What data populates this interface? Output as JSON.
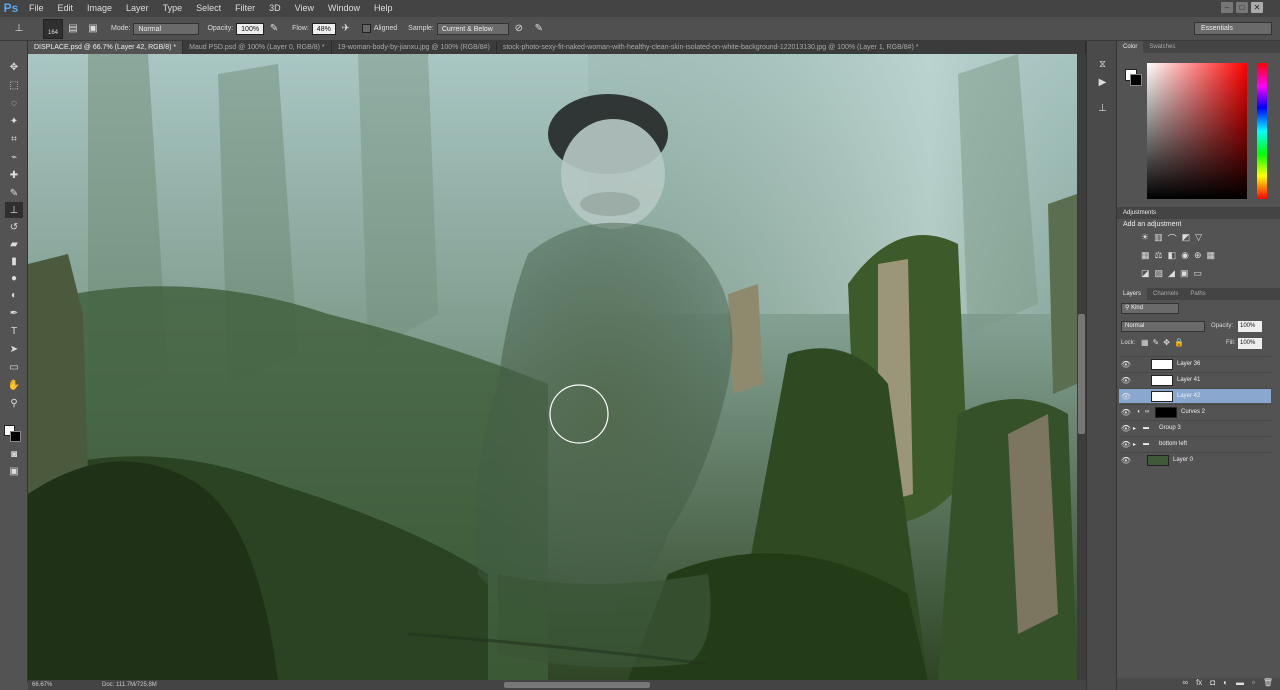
{
  "app": {
    "logo": "Ps"
  },
  "menu": [
    "File",
    "Edit",
    "Image",
    "Layer",
    "Type",
    "Select",
    "Filter",
    "3D",
    "View",
    "Window",
    "Help"
  ],
  "options": {
    "brush_size": "164",
    "mode_label": "Mode:",
    "mode_value": "Normal",
    "opacity_label": "Opacity:",
    "opacity_value": "100%",
    "flow_label": "Flow:",
    "flow_value": "48%",
    "aligned_label": "Aligned",
    "sample_label": "Sample:",
    "sample_value": "Current & Below",
    "workspace": "Essentials"
  },
  "tabs": [
    "DISPLACE.psd @ 66.7% (Layer 42, RGB/8) *",
    "Maud PSD.psd @ 100% (Layer 0, RGB/8) *",
    "19-woman-body-by-jianxu.jpg @ 100% (RGB/8#)",
    "stock-photo-sexy-fit-naked-woman-with-healthy-clean-skin-isolated-on-white-background-122013130.jpg @ 100% (Layer 1, RGB/8#) *"
  ],
  "status": {
    "zoom": "66.67%",
    "doc": "Doc: 111.7M/725.8M"
  },
  "color_panel": {
    "tab1": "Color",
    "tab2": "Swatches"
  },
  "adjustments": {
    "title": "Adjustments",
    "subtitle": "Add an adjustment"
  },
  "layers_panel": {
    "tabs": [
      "Layers",
      "Channels",
      "Paths"
    ],
    "kind": "Kind",
    "blend": "Normal",
    "opacity_label": "Opacity:",
    "opacity_value": "100%",
    "lock_label": "Lock:",
    "fill_label": "Fill:",
    "fill_value": "100%",
    "layers": [
      {
        "name": "Layer 36"
      },
      {
        "name": "Layer 41"
      },
      {
        "name": "Layer 42"
      },
      {
        "name": "Curves 2"
      },
      {
        "name": "Group 3"
      },
      {
        "name": "bottom left"
      },
      {
        "name": "Layer 0"
      }
    ]
  },
  "colors": {
    "accent": "#8aa8cf"
  }
}
